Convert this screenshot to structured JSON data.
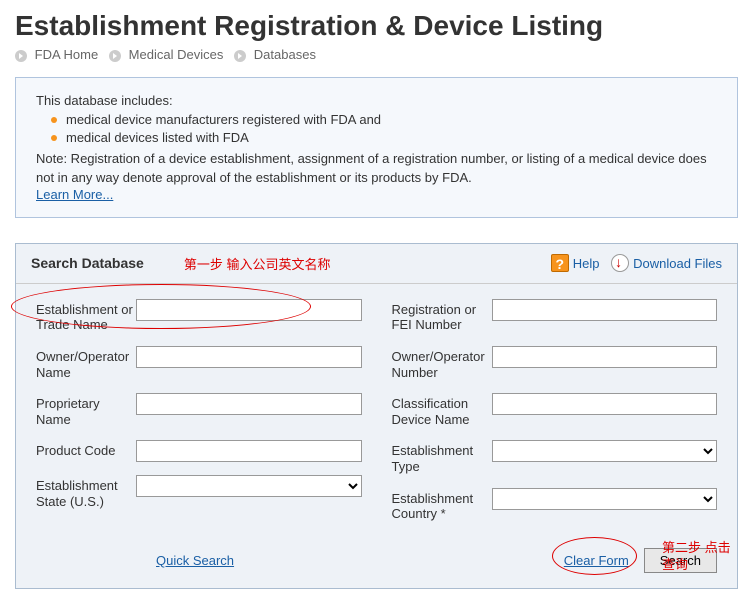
{
  "page_title": "Establishment Registration & Device Listing",
  "breadcrumb": {
    "items": [
      "FDA Home",
      "Medical Devices",
      "Databases"
    ]
  },
  "info": {
    "intro": "This database includes:",
    "bullets": [
      "medical device manufacturers registered with FDA and",
      "medical devices listed with FDA"
    ],
    "note": "Note: Registration of a device establishment, assignment of a registration number, or listing of a medical device does not in any way denote approval of the establishment or its products by FDA.",
    "learn_more": "Learn More..."
  },
  "search": {
    "title": "Search Database",
    "annotation_1": "第一步 输入公司英文名称",
    "help_label": "Help",
    "download_label": "Download Files",
    "fields_left": {
      "establishment_name": {
        "label": "Establishment or Trade Name",
        "value": ""
      },
      "owner_name": {
        "label": "Owner/Operator Name",
        "value": ""
      },
      "proprietary_name": {
        "label": "Proprietary Name",
        "value": ""
      },
      "product_code": {
        "label": "Product Code",
        "value": ""
      },
      "establishment_state": {
        "label": "Establishment State (U.S.)",
        "value": ""
      }
    },
    "fields_right": {
      "registration_number": {
        "label": "Registration or FEI Number",
        "value": ""
      },
      "owner_number": {
        "label": "Owner/Operator Number",
        "value": ""
      },
      "classification_name": {
        "label": "Classification Device Name",
        "value": ""
      },
      "establishment_type": {
        "label": "Establishment Type",
        "value": ""
      },
      "establishment_country": {
        "label": "Establishment Country *",
        "value": ""
      }
    },
    "quick_search": "Quick Search",
    "clear_form": "Clear Form",
    "search_btn": "Search",
    "annotation_2": "第二步 点击查询"
  }
}
